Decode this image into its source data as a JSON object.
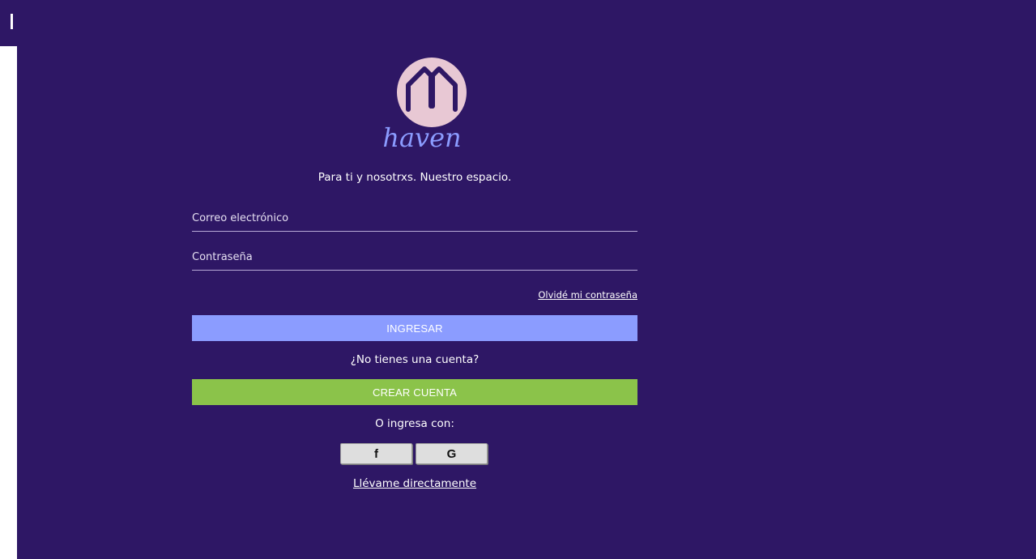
{
  "brand": {
    "wordmark": "haven",
    "tagline": "Para ti y nosotrxs. Nuestro espacio."
  },
  "login": {
    "email_placeholder": "Correo electrónico",
    "password_placeholder": "Contraseña",
    "forgot_label": "Olvidé mi contraseña",
    "login_label": "INGRESAR",
    "no_account_text": "¿No tienes una cuenta?",
    "create_label": "CREAR CUENTA",
    "or_with_text": "O ingresa con:",
    "facebook_label": "f",
    "google_label": "G",
    "direct_label": "Llévame directamente"
  },
  "colors": {
    "background": "#2e1765",
    "login_button": "#8b9cff",
    "create_button": "#8bc34a",
    "logo_circle": "#e8c8d4",
    "wordmark": "#8b9cff"
  },
  "icons": {
    "logo": "house-icon",
    "facebook": "facebook-icon",
    "google": "google-icon"
  }
}
